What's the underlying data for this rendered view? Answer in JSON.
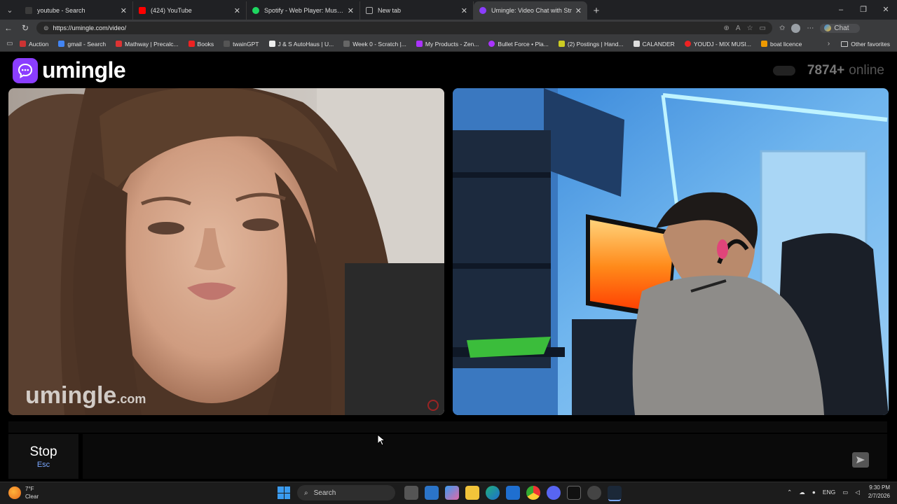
{
  "browser": {
    "tabs": [
      {
        "label": "youtube - Search",
        "color": "#3b3b3b",
        "active": false
      },
      {
        "label": "(424) YouTube",
        "color": "#ff0000",
        "active": false
      },
      {
        "label": "Spotify - Web Player: Music for ev",
        "color": "#1ed760",
        "active": false
      },
      {
        "label": "New tab",
        "color": "#888888",
        "active": false
      },
      {
        "label": "Umingle: Video Chat with Str",
        "color": "#8b3dff",
        "active": true
      }
    ],
    "url": "https://umingle.com/video/",
    "chat_label": "Chat",
    "bookmarks": [
      {
        "label": "Auction",
        "color": "#c33"
      },
      {
        "label": "gmail - Search",
        "color": "#4285f4"
      },
      {
        "label": "Mathway | Precalc...",
        "color": "#d33"
      },
      {
        "label": "Books",
        "color": "#e22"
      },
      {
        "label": "twainGPT",
        "color": "#333"
      },
      {
        "label": "J & S AutoHaus | U...",
        "color": "#eee"
      },
      {
        "label": "Week 0 - Scratch |...",
        "color": "#666"
      },
      {
        "label": "My Products - Zen...",
        "color": "#a3f"
      },
      {
        "label": "Bullet Force • Pla...",
        "color": "#a3f"
      },
      {
        "label": "(2) Postings | Hand...",
        "color": "#cc2"
      },
      {
        "label": "CALANDER",
        "color": "#ddd"
      },
      {
        "label": "YOUDJ - MIX MUSI...",
        "color": "#e22"
      },
      {
        "label": "boat licence",
        "color": "#e90"
      }
    ],
    "other_favorites": "Other favorites"
  },
  "site": {
    "logo_text": "umingle",
    "online_count": "7874+",
    "online_label": "online",
    "brand_color": "#8b3dff",
    "watermark_main": "umingle",
    "watermark_suffix": ".com",
    "stop_label": "Stop",
    "stop_key": "Esc"
  },
  "taskbar": {
    "weather_temp": "7°F",
    "weather_desc": "Clear",
    "search_label": "Search",
    "lang": "ENG",
    "time": "9:30 PM",
    "date": "2/7/2026"
  }
}
